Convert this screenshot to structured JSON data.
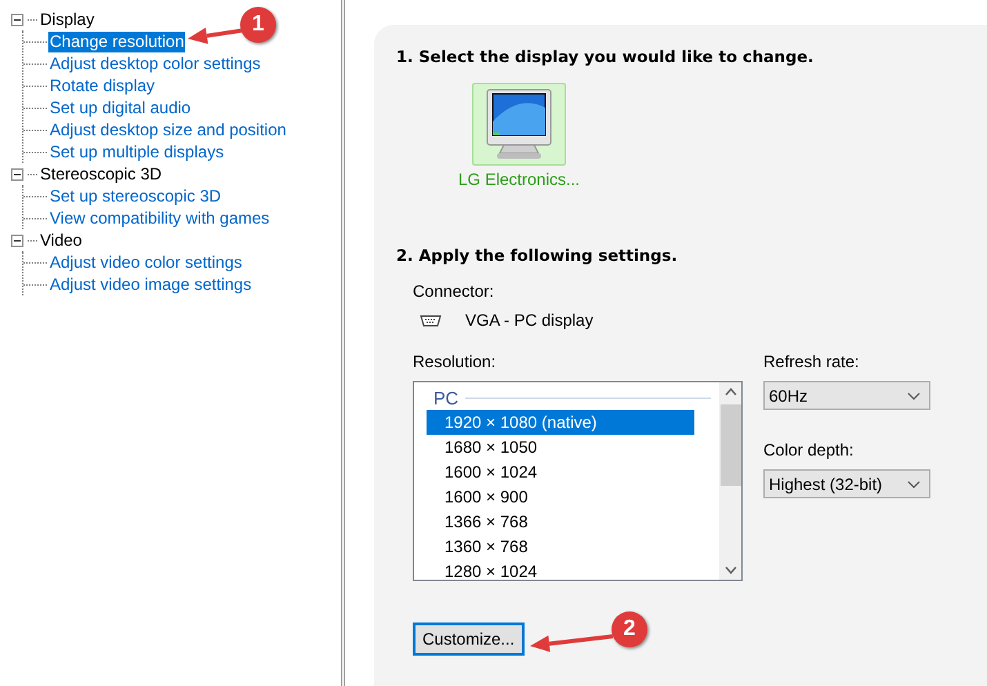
{
  "tree": [
    {
      "label": "Display",
      "expanded": true,
      "children": [
        {
          "label": "Change resolution",
          "selected": true
        },
        {
          "label": "Adjust desktop color settings",
          "selected": false
        },
        {
          "label": "Rotate display",
          "selected": false
        },
        {
          "label": "Set up digital audio",
          "selected": false
        },
        {
          "label": "Adjust desktop size and position",
          "selected": false
        },
        {
          "label": "Set up multiple displays",
          "selected": false
        }
      ]
    },
    {
      "label": "Stereoscopic 3D",
      "expanded": true,
      "children": [
        {
          "label": "Set up stereoscopic 3D",
          "selected": false
        },
        {
          "label": "View compatibility with games",
          "selected": false
        }
      ]
    },
    {
      "label": "Video",
      "expanded": true,
      "children": [
        {
          "label": "Adjust video color settings",
          "selected": false
        },
        {
          "label": "Adjust video image settings",
          "selected": false
        }
      ]
    }
  ],
  "section1": {
    "title": "1. Select the display you would like to change.",
    "displays": [
      {
        "label": "LG Electronics...",
        "selected": true
      }
    ]
  },
  "section2": {
    "title": "2. Apply the following settings.",
    "connector_label": "Connector:",
    "connector": "VGA - PC display",
    "resolution_label": "Resolution:",
    "resolution_group": "PC",
    "resolutions": [
      {
        "label": "1920 × 1080 (native)",
        "selected": true
      },
      {
        "label": "1680 × 1050",
        "selected": false
      },
      {
        "label": "1600 × 1024",
        "selected": false
      },
      {
        "label": "1600 × 900",
        "selected": false
      },
      {
        "label": "1366 × 768",
        "selected": false
      },
      {
        "label": "1360 × 768",
        "selected": false
      },
      {
        "label": "1280 × 1024",
        "selected": false
      }
    ],
    "refresh_rate": {
      "label": "Refresh rate:",
      "value": "60Hz"
    },
    "color_depth": {
      "label": "Color depth:",
      "value": "Highest (32-bit)"
    },
    "customize_button": "Customize..."
  },
  "annotations": [
    {
      "number": "1"
    },
    {
      "number": "2"
    }
  ]
}
